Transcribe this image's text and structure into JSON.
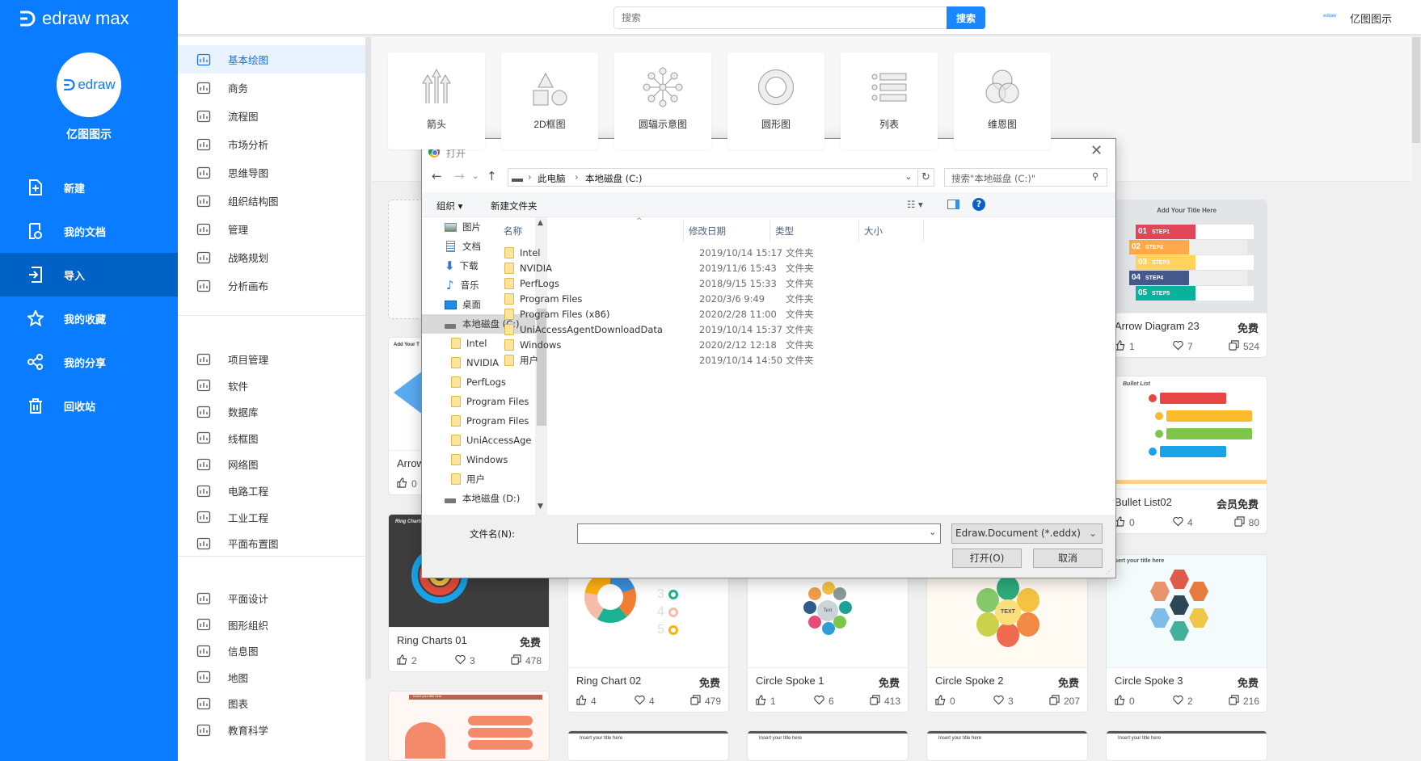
{
  "app": {
    "logo_text": "edraw max",
    "avatar_text": "edraw",
    "user_name": "亿图图示"
  },
  "sidebar": {
    "items": [
      {
        "label": "新建",
        "icon": "file-plus-icon"
      },
      {
        "label": "我的文档",
        "icon": "documents-icon"
      },
      {
        "label": "导入",
        "icon": "import-icon",
        "active": true
      },
      {
        "label": "我的收藏",
        "icon": "star-icon"
      },
      {
        "label": "我的分享",
        "icon": "share-icon"
      },
      {
        "label": "回收站",
        "icon": "trash-icon"
      }
    ]
  },
  "header": {
    "search_placeholder": "搜索",
    "search_button": "搜索",
    "logo_small": "edraw",
    "user": "亿图图示"
  },
  "categories": {
    "groups": [
      [
        "基本绘图",
        "商务",
        "流程图",
        "市场分析",
        "思维导图",
        "组织结构图",
        "管理",
        "战略规划",
        "分析画布"
      ],
      [
        "项目管理",
        "软件",
        "数据库",
        "线框图",
        "网络图",
        "电路工程",
        "工业工程",
        "平面布置图"
      ],
      [
        "平面设计",
        "图形组织",
        "信息图",
        "地图",
        "图表",
        "教育科学"
      ]
    ],
    "active": "基本绘图"
  },
  "shape_types": [
    "箭头",
    "2D框图",
    "圆辐示意图",
    "圆形图",
    "列表",
    "维恩图"
  ],
  "templates": [
    {
      "col": 0,
      "kind": "blank"
    },
    {
      "col": 0,
      "kind": "arrow",
      "title": "Arrow",
      "likes": "0",
      "preview_title": "Add Your T"
    },
    {
      "col": 0,
      "kind": "ringdark",
      "title": "Ring Charts 01",
      "badge": "免费",
      "likes": "2",
      "favs": "3",
      "copies": "478",
      "preview_title": "Ring Charts"
    },
    {
      "col": 0,
      "kind": "orange",
      "preview_title": "Insert your title here"
    },
    {
      "col": 1,
      "kind": "ringlight",
      "title": "Ring Chart 02",
      "badge": "免费",
      "likes": "4",
      "favs": "4",
      "copies": "479"
    },
    {
      "col": 1,
      "kind": "plain",
      "preview_title": "Insert your title here"
    },
    {
      "col": 2,
      "kind": "spoke1",
      "title": "Circle Spoke 1",
      "badge": "免费",
      "likes": "1",
      "favs": "6",
      "copies": "413",
      "preview_title": "Text"
    },
    {
      "col": 2,
      "kind": "plain",
      "preview_title": "Insert your title here"
    },
    {
      "col": 3,
      "kind": "spoke2",
      "title": "Circle Spoke 2",
      "badge": "免费",
      "likes": "0",
      "favs": "3",
      "copies": "207",
      "preview_title": "TEXT"
    },
    {
      "col": 3,
      "kind": "plain",
      "preview_title": "Insert your title here"
    },
    {
      "col": 4,
      "kind": "steps",
      "title": "Arrow Diagram 23",
      "badge": "免费",
      "likes": "1",
      "favs": "7",
      "copies": "524",
      "preview_title": "Add Your Title Here",
      "steps": [
        "STEP1",
        "STEP2",
        "STEP3",
        "STEP4",
        "STEP5"
      ]
    },
    {
      "col": 4,
      "kind": "bullet",
      "title": "Bullet List02",
      "badge": "会员免费",
      "likes": "0",
      "favs": "4",
      "copies": "80",
      "preview_title": "Bullet List"
    },
    {
      "col": 4,
      "kind": "hex",
      "title": "Circle Spoke 3",
      "badge": "免费",
      "likes": "0",
      "favs": "2",
      "copies": "216",
      "preview_title": "Insert your title here"
    },
    {
      "col": 4,
      "kind": "plain",
      "preview_title": "Insert your title here"
    }
  ],
  "dialog": {
    "title": "打开",
    "breadcrumb": [
      "此电脑",
      "本地磁盘 (C:)"
    ],
    "search_placeholder": "搜索\"本地磁盘 (C:)\"",
    "toolbar": {
      "organize": "组织",
      "new_folder": "新建文件夹"
    },
    "nav_items": [
      {
        "label": "图片",
        "icon": "pictures-icon"
      },
      {
        "label": "文档",
        "icon": "documents-icon"
      },
      {
        "label": "下载",
        "icon": "download-icon"
      },
      {
        "label": "音乐",
        "icon": "music-icon"
      },
      {
        "label": "桌面",
        "icon": "desktop-icon"
      },
      {
        "label": "本地磁盘 (C:)",
        "icon": "drive-icon",
        "selected": true
      },
      {
        "label": "Intel",
        "icon": "folder-icon",
        "indent": true
      },
      {
        "label": "NVIDIA",
        "icon": "folder-icon",
        "indent": true
      },
      {
        "label": "PerfLogs",
        "icon": "folder-icon",
        "indent": true
      },
      {
        "label": "Program Files",
        "icon": "folder-icon",
        "indent": true
      },
      {
        "label": "Program Files",
        "icon": "folder-icon",
        "indent": true
      },
      {
        "label": "UniAccessAge",
        "icon": "folder-icon",
        "indent": true
      },
      {
        "label": "Windows",
        "icon": "folder-icon",
        "indent": true
      },
      {
        "label": "用户",
        "icon": "folder-icon",
        "indent": true
      },
      {
        "label": "本地磁盘 (D:)",
        "icon": "drive-icon"
      }
    ],
    "columns": [
      "名称",
      "修改日期",
      "类型",
      "大小"
    ],
    "files": [
      {
        "name": "Intel",
        "date": "2019/10/14 15:17",
        "type": "文件夹"
      },
      {
        "name": "NVIDIA",
        "date": "2019/11/6 15:43",
        "type": "文件夹"
      },
      {
        "name": "PerfLogs",
        "date": "2018/9/15 15:33",
        "type": "文件夹"
      },
      {
        "name": "Program Files",
        "date": "2020/3/6 9:49",
        "type": "文件夹"
      },
      {
        "name": "Program Files (x86)",
        "date": "2020/2/28 11:00",
        "type": "文件夹"
      },
      {
        "name": "UniAccessAgentDownloadData",
        "date": "2019/10/14 15:37",
        "type": "文件夹"
      },
      {
        "name": "Windows",
        "date": "2020/2/12 12:18",
        "type": "文件夹"
      },
      {
        "name": "用户",
        "date": "2019/10/14 14:50",
        "type": "文件夹"
      }
    ],
    "filename_label": "文件名(N):",
    "filename_value": "",
    "filter": "Edraw.Document (*.eddx)",
    "open_button": "打开(O)",
    "cancel_button": "取消"
  }
}
